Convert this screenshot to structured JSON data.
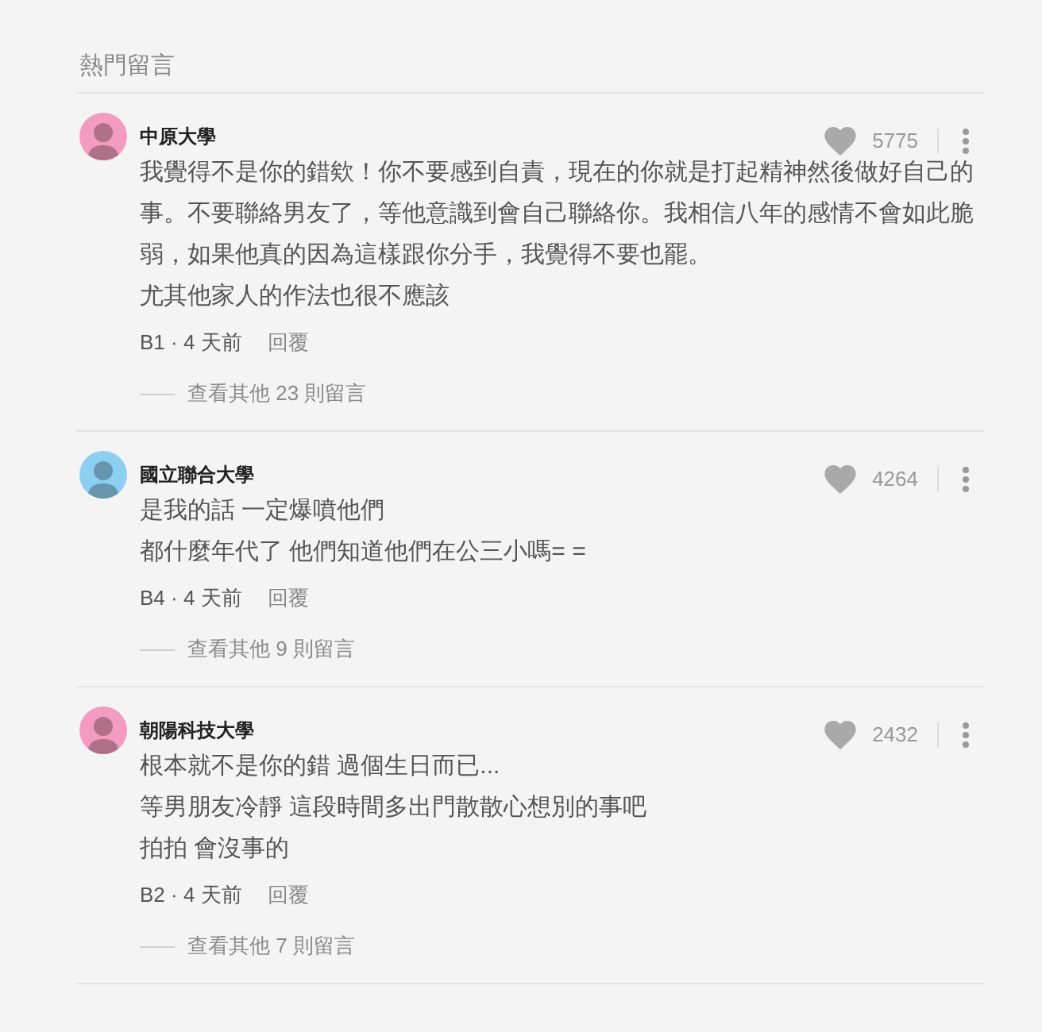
{
  "section": {
    "title": "熱門留言"
  },
  "comments": [
    {
      "author": "中原大學",
      "color": "#f49cc0",
      "likes": "5775",
      "paragraphs": [
        "我覺得不是你的錯欸！你不要感到自責，現在的你就是打起精神然後做好自己的事。不要聯絡男友了，等他意識到會自己聯絡你。我相信八年的感情不會如此脆弱，如果他真的因為這樣跟你分手，我覺得不要也罷。",
        "尤其他家人的作法也很不應該"
      ],
      "posted": "B1 · 4 天前",
      "reply": "回覆",
      "more_replies": "查看其他 23 則留言"
    },
    {
      "author": "國立聯合大學",
      "color": "#8dcff0",
      "likes": "4264",
      "paragraphs": [
        "是我的話 一定爆噴他們",
        "都什麼年代了 他們知道他們在公三小嗎= ="
      ],
      "posted": "B4 · 4 天前",
      "reply": "回覆",
      "more_replies": "查看其他 9 則留言"
    },
    {
      "author": "朝陽科技大學",
      "color": "#f49cc0",
      "likes": "2432",
      "paragraphs": [
        "根本就不是你的錯 過個生日而已...",
        "等男朋友冷靜 這段時間多出門散散心想別的事吧",
        "拍拍 會沒事的"
      ],
      "posted": "B2 · 4 天前",
      "reply": "回覆",
      "more_replies": "查看其他 7 則留言"
    }
  ]
}
